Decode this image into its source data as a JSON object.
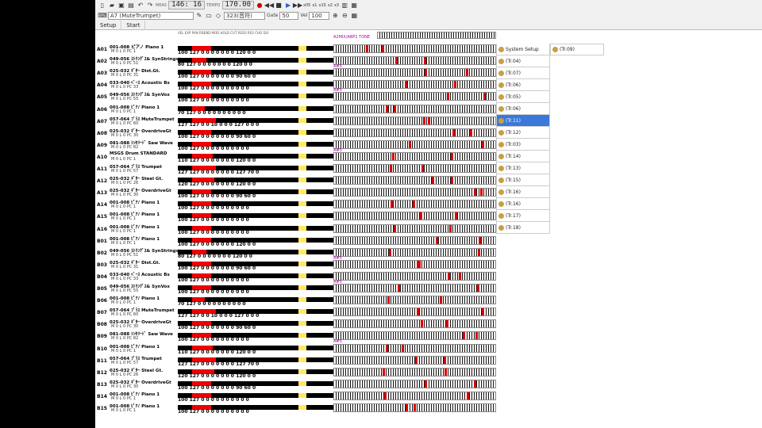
{
  "toolbar1": {
    "meas_label": "MEAS",
    "position": "146: 16",
    "tempo_label": "TEMPO",
    "tempo": "170.00",
    "speeds": [
      "x05",
      "x1",
      "x15",
      "x2",
      "x3"
    ]
  },
  "toolbar2": {
    "track_select": "A7 (MuteTrumpet)",
    "channel_select": "323(音符)",
    "gate_label": "Gate",
    "gate_value": "50",
    "vel_label": "Vel",
    "vel_value": "100"
  },
  "tabs": [
    "Setup",
    "Start"
  ],
  "header_labels": "VEL EXP PAN P.BEND MOD HOLD CUT RESO REV CHO DLY",
  "top_annotation": "A2MIX/ABP1 TONE",
  "tracks": [
    {
      "id": "A01",
      "name": "001-008 ピアノ Piano 1",
      "sub": "M 0 L 0 PC 1",
      "vals": "100 127 0 0 0 0 0 0 0 120 0 0",
      "red": 24
    },
    {
      "id": "A02",
      "name": "049-056 ｽﾄﾘﾝｸﾞｽ& SynStrings1",
      "sub": "M 0 L 0 PC 51",
      "vals": "80 127 0 0 0 0 0 0 0 120 0 0",
      "red": 18,
      "ann": "A#5"
    },
    {
      "id": "A03",
      "name": "025-032 ｷﾞﾀｰ Dist.Gt.",
      "sub": "M 0 L 0 PC 31",
      "vals": "100 127 0 0 0 0 0 0 0 90 60 0",
      "red": 24
    },
    {
      "id": "A04",
      "name": "033-040 ﾍﾞｰｽ Acoustic Bs",
      "sub": "M 0 L 0 PC 33",
      "vals": "100 127 0 0 0 0 0 0 0 0 0 0",
      "red": 24,
      "ann": "A#5"
    },
    {
      "id": "A05",
      "name": "049-056 ｽﾄﾘﾝｸﾞｽ& SynVox",
      "sub": "M 0 L 0 PC 55",
      "vals": "100 127 0 0 0 0 0 0 0 0 0 0",
      "red": 24
    },
    {
      "id": "A06",
      "name": "001-008 ﾋﾟｱﾉ Piano 1",
      "sub": "M 0 L 0 PC 1",
      "vals": "70 127 0 0 0 0 0 0 0 0 0 0",
      "red": 16
    },
    {
      "id": "A07",
      "name": "057-064 ﾌﾞﾗｽ MuteTrumpet",
      "sub": "M 0 L 0 PC 60",
      "vals": "127 127 0 0 10 0 0 0 127 0 0 0",
      "red": 30
    },
    {
      "id": "A08",
      "name": "025-032 ｷﾞﾀｰ OverdriveGt",
      "sub": "M 0 L 0 PC 30",
      "vals": "100 127 0 0 0 0 0 0 0 90 60 0",
      "red": 24
    },
    {
      "id": "A09",
      "name": "081-088 ｼﾝｾﾘｰﾄﾞ Saw Wave",
      "sub": "M 0 L 0 PC 82",
      "vals": "100 127 0 0 0 0 0 0 0 0 0 0",
      "red": 24,
      "ann": "A#5"
    },
    {
      "id": "A10",
      "name": "MSGS Drum STANDARD",
      "sub": "M 0 L 0 PC 1",
      "vals": "110 127 0 0 0 0 0 0 0 120 0 0",
      "red": 26
    },
    {
      "id": "A11",
      "name": "057-064 ﾌﾞﾗｽ Trumpet",
      "sub": "M 0 L 0 PC 57",
      "vals": "127 127 0 0 0 0 0 0 0 127 70 0",
      "red": 30
    },
    {
      "id": "A12",
      "name": "025-032 ｷﾞﾀｰ Steel Gt.",
      "sub": "M 0 L 0 PC 26",
      "vals": "120 127 0 0 0 0 0 0 0 120 0 0",
      "red": 28
    },
    {
      "id": "A13",
      "name": "025-032 ｷﾞﾀｰ OverdriveGt",
      "sub": "M 0 L 0 PC 30",
      "vals": "100 127 0 0 0 0 0 0 0 90 60 0",
      "red": 24
    },
    {
      "id": "A14",
      "name": "001-008 ﾋﾟｱﾉ Piano 1",
      "sub": "M 0 L 0 PC 1",
      "vals": "100 127 0 0 0 0 0 0 0 0 0 0",
      "red": 24
    },
    {
      "id": "A15",
      "name": "001-008 ﾋﾟｱﾉ Piano 1",
      "sub": "M 0 L 0 PC 1",
      "vals": "100 127 0 0 0 0 0 0 0 0 0 0",
      "red": 24
    },
    {
      "id": "A16",
      "name": "001-008 ﾋﾟｱﾉ Piano 1",
      "sub": "M 0 L 0 PC 1",
      "vals": "100 127 0 0 0 0 0 0 0 0 0 0",
      "red": 24
    },
    {
      "id": "B01",
      "name": "001-008 ﾋﾟｱﾉ Piano 1",
      "sub": "M 0 L 0 PC 1",
      "vals": "100 127 0 0 0 0 0 0 0 120 0 0",
      "red": 24
    },
    {
      "id": "B02",
      "name": "049-056 ｽﾄﾘﾝｸﾞｽ& SynStrings1",
      "sub": "M 0 L 0 PC 51",
      "vals": "80 127 0 0 0 0 0 0 0 120 0 0",
      "red": 18,
      "ann": "A#5"
    },
    {
      "id": "B03",
      "name": "025-032 ｷﾞﾀｰ Dist.Gt.",
      "sub": "M 0 L 0 PC 31",
      "vals": "100 127 0 0 0 0 0 0 0 90 60 0",
      "red": 24
    },
    {
      "id": "B04",
      "name": "033-040 ﾍﾞｰｽ Acoustic Bs",
      "sub": "M 0 L 0 PC 33",
      "vals": "100 127 0 0 0 0 0 0 0 0 0 0",
      "red": 24,
      "ann": "A#5"
    },
    {
      "id": "B05",
      "name": "049-056 ｽﾄﾘﾝｸﾞｽ& SynVox",
      "sub": "M 0 L 0 PC 55",
      "vals": "100 127 0 0 0 0 0 0 0 0 0 0",
      "red": 24
    },
    {
      "id": "B06",
      "name": "001-008 ﾋﾟｱﾉ Piano 1",
      "sub": "M 0 L 0 PC 1",
      "vals": "70 127 0 0 0 0 0 0 0 0 0 0",
      "red": 16
    },
    {
      "id": "B07",
      "name": "057-064 ﾌﾞﾗｽ MuteTrumpet",
      "sub": "M 0 L 0 PC 60",
      "vals": "127 127 0 0 10 0 0 0 127 0 0 0",
      "red": 30
    },
    {
      "id": "B08",
      "name": "025-032 ｷﾞﾀｰ OverdriveGt",
      "sub": "M 0 L 0 PC 30",
      "vals": "100 127 0 0 0 0 0 0 0 90 60 0",
      "red": 24
    },
    {
      "id": "B09",
      "name": "081-088 ｼﾝｾﾘｰﾄﾞ Saw Wave",
      "sub": "M 0 L 0 PC 82",
      "vals": "100 127 0 0 0 0 0 0 0 0 0 0",
      "red": 24,
      "ann": "A#5"
    },
    {
      "id": "B10",
      "name": "001-008 ﾋﾟｱﾉ Piano 1",
      "sub": "M 0 L 0 PC 1",
      "vals": "110 127 0 0 0 0 0 0 0 120 0 0",
      "red": 26
    },
    {
      "id": "B11",
      "name": "057-064 ﾌﾞﾗｽ Trumpet",
      "sub": "M 0 L 0 PC 57",
      "vals": "127 127 0 0 0 0 0 0 0 127 70 0",
      "red": 30
    },
    {
      "id": "B12",
      "name": "025-032 ｷﾞﾀｰ Steel Gt.",
      "sub": "M 0 L 0 PC 26",
      "vals": "120 127 0 0 0 0 0 0 0 120 0 0",
      "red": 28
    },
    {
      "id": "B13",
      "name": "025-032 ｷﾞﾀｰ OverdriveGt",
      "sub": "M 0 L 0 PC 30",
      "vals": "100 127 0 0 0 0 0 0 0 90 60 0",
      "red": 24
    },
    {
      "id": "B14",
      "name": "001-008 ﾋﾟｱﾉ Piano 1",
      "sub": "M 0 L 0 PC 1",
      "vals": "100 127 0 0 0 0 0 0 0 0 0 0",
      "red": 24
    },
    {
      "id": "B15",
      "name": "001-008 ﾋﾟｱﾉ Piano 1",
      "sub": "M 0 L 0 PC 1",
      "vals": "100 127 0 0 0 0 0 0 0 0 0 0",
      "red": 24
    }
  ],
  "side_items": [
    "System Setup",
    "(Tr.04)",
    "(Tr.07)",
    "(Tr.06)",
    "(Tr.05)",
    "(Tr.06)",
    "(Tr.11)",
    "(Tr.12)",
    "(Tr.03)",
    "(Tr.14)",
    "(Tr.13)",
    "(Tr.15)",
    "(Tr.16)",
    "(Tr.16)",
    "(Tr.17)",
    "(Tr.18)"
  ],
  "side_selected": 6,
  "side2_item": "(Tr.09)"
}
